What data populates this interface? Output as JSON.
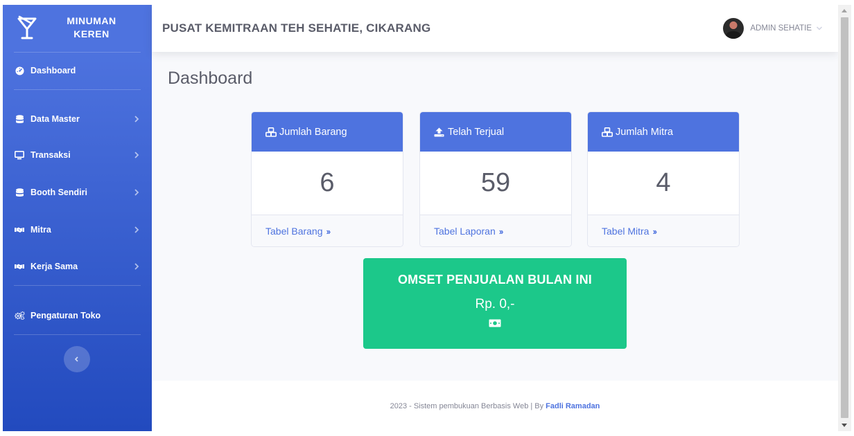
{
  "sidebar": {
    "brand_line1": "MINUMAN",
    "brand_line2": "KEREN",
    "items": [
      {
        "label": "Dashboard",
        "icon": "tachometer-icon"
      },
      {
        "label": "Data Master",
        "icon": "database-icon"
      },
      {
        "label": "Transaksi",
        "icon": "desktop-icon"
      },
      {
        "label": "Booth Sendiri",
        "icon": "database-icon"
      },
      {
        "label": "Mitra",
        "icon": "handshake-icon"
      },
      {
        "label": "Kerja Sama",
        "icon": "handshake-icon"
      },
      {
        "label": "Pengaturan Toko",
        "icon": "cogs-icon"
      }
    ]
  },
  "topbar": {
    "title": "PUSAT KEMITRAAN TEH SEHATIE, CIKARANG",
    "user_name": "ADMIN SEHATIE"
  },
  "page": {
    "heading": "Dashboard"
  },
  "cards": [
    {
      "title": "Jumlah Barang",
      "value": "6",
      "link": "Tabel Barang",
      "icon": "cubes-icon"
    },
    {
      "title": "Telah Terjual",
      "value": "59",
      "link": "Tabel Laporan",
      "icon": "upload-icon"
    },
    {
      "title": "Jumlah Mitra",
      "value": "4",
      "link": "Tabel Mitra",
      "icon": "cubes-icon"
    }
  ],
  "omset": {
    "title": "OMSET PENJUALAN BULAN INI",
    "value": "Rp. 0,-",
    "icon": "money-bill-icon"
  },
  "footer": {
    "text": "2023 - Sistem pembukuan Berbasis Web | By",
    "author": "Fadli Ramadan"
  },
  "colors": {
    "primary": "#4e73df",
    "success": "#1cc88a",
    "text": "#5a5c69"
  }
}
